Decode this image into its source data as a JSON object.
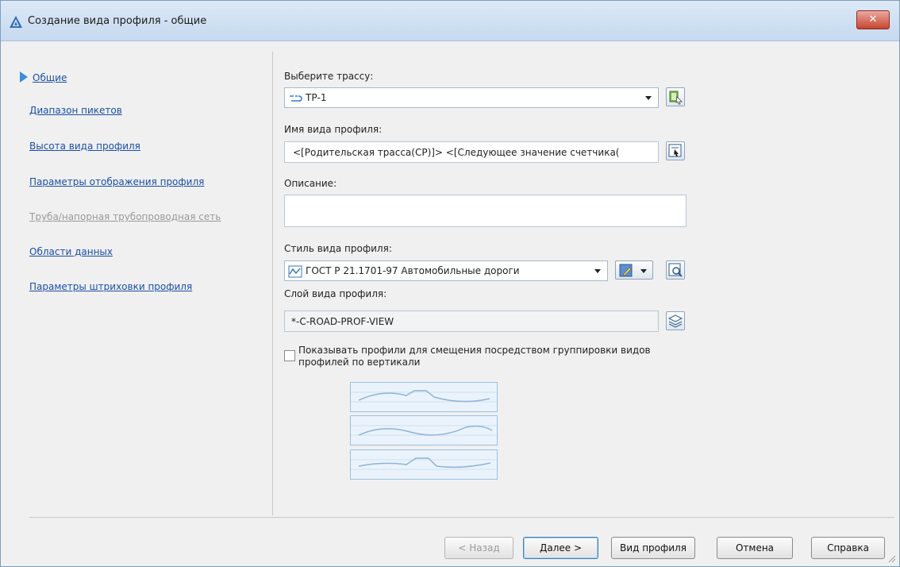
{
  "window": {
    "title": "Создание вида профиля - общие",
    "close_label": "✕"
  },
  "nav": [
    {
      "label": "Общие",
      "active": true,
      "enabled": true
    },
    {
      "label": "Диапазон пикетов",
      "enabled": true
    },
    {
      "label": "Высота вида профиля",
      "enabled": true
    },
    {
      "label": "Параметры отображения профиля",
      "enabled": true
    },
    {
      "label": "Труба/напорная трубопроводная сеть",
      "enabled": false
    },
    {
      "label": "Области данных",
      "enabled": true
    },
    {
      "label": "Параметры штриховки профиля",
      "enabled": true
    }
  ],
  "form": {
    "alignment_label": "Выберите трассу:",
    "alignment_value": "ТР-1",
    "name_label": "Имя вида профиля:",
    "name_value": "<[Родительская трасса(CP)]> <[Следующее значение счетчика(",
    "description_label": "Описание:",
    "description_value": "",
    "style_label": "Стиль вида профиля:",
    "style_value": "ГОСТ Р 21.1701-97 Автомобильные дороги",
    "layer_label": "Слой вида профиля:",
    "layer_value": "*-C-ROAD-PROF-VIEW",
    "checkbox_label": "Показывать профили для смещения посредством группировки видов профилей по вертикали",
    "checkbox_checked": false
  },
  "buttons": {
    "back": "< Назад",
    "next": "Далее >",
    "profile_view": "Вид профиля",
    "cancel": "Отмена",
    "help": "Справка"
  },
  "colors": {
    "accent": "#3a8ee0",
    "link": "#1a4fa8",
    "disabled": "#9a9a9a"
  }
}
